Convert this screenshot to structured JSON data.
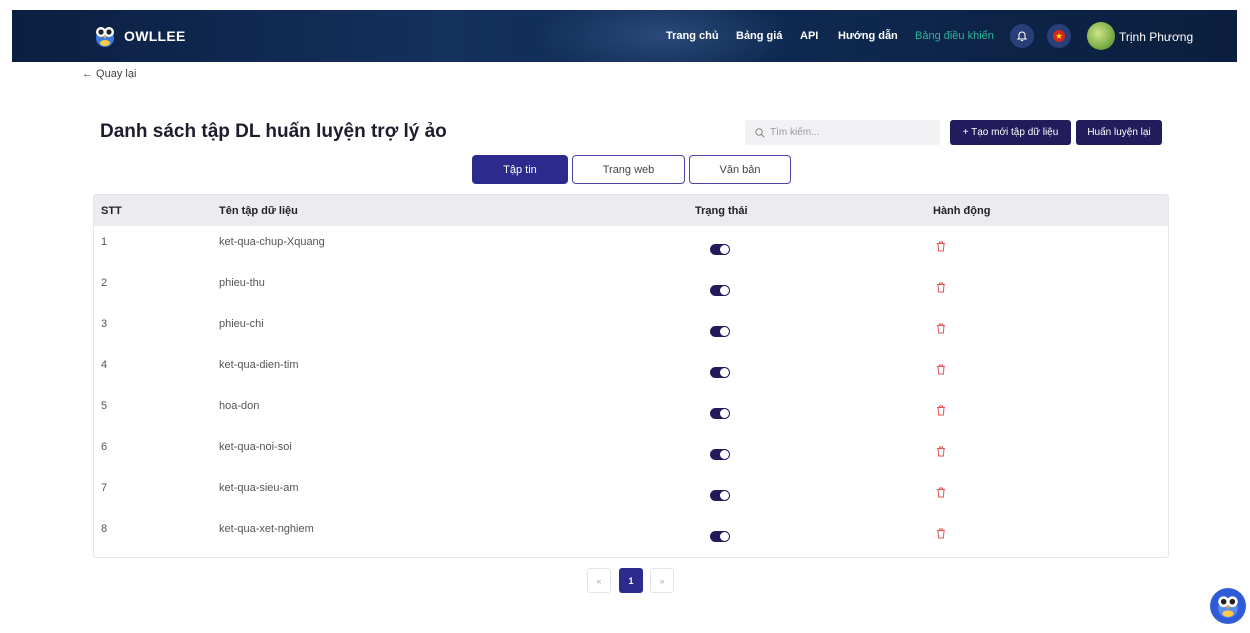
{
  "header": {
    "brand": "OWLLEE",
    "nav": [
      "Trang chủ",
      "Bảng giá",
      "API",
      "Hướng dẫn",
      "Bảng điều khiển"
    ],
    "username": "Trịnh Phương"
  },
  "back_label": "← Quay lại",
  "page_title": "Danh sách tập DL huấn luyện trợ lý ảo",
  "search": {
    "placeholder": "Tìm kiếm..."
  },
  "buttons": {
    "new_dataset": "+ Tạo mới tập dữ liệu",
    "retrain": "Huấn luyện lại"
  },
  "tabs": [
    "Tập tin",
    "Trang web",
    "Văn bản"
  ],
  "active_tab": "Tập tin",
  "table": {
    "headers": [
      "STT",
      "Tên tập dữ liệu",
      "Trạng thái",
      "Hành động"
    ],
    "rows": [
      {
        "idx": "1",
        "name": "ket-qua-chup-Xquang",
        "enabled": true
      },
      {
        "idx": "2",
        "name": "phieu-thu",
        "enabled": true
      },
      {
        "idx": "3",
        "name": "phieu-chi",
        "enabled": true
      },
      {
        "idx": "4",
        "name": "ket-qua-dien-tim",
        "enabled": true
      },
      {
        "idx": "5",
        "name": "hoa-don",
        "enabled": true
      },
      {
        "idx": "6",
        "name": "ket-qua-noi-soi",
        "enabled": true
      },
      {
        "idx": "7",
        "name": "ket-qua-sieu-am",
        "enabled": true
      },
      {
        "idx": "8",
        "name": "ket-qua-xet-nghiem",
        "enabled": true
      }
    ]
  },
  "pagination": {
    "prev": "«",
    "current": "1",
    "next": "»"
  },
  "icons": {
    "logo": "owl-logo-icon",
    "bell": "bell-icon",
    "flag": "vietnam-flag-icon",
    "search": "search-icon",
    "delete": "trash-icon",
    "chat": "owl-chat-icon"
  },
  "colors": {
    "header_bg": "#0f2a52",
    "primary": "#2d2a8e",
    "button_dark": "#231c5c",
    "active_nav": "#2fb59a",
    "delete_red": "#e25555",
    "toggle_on": "#221a5a"
  }
}
